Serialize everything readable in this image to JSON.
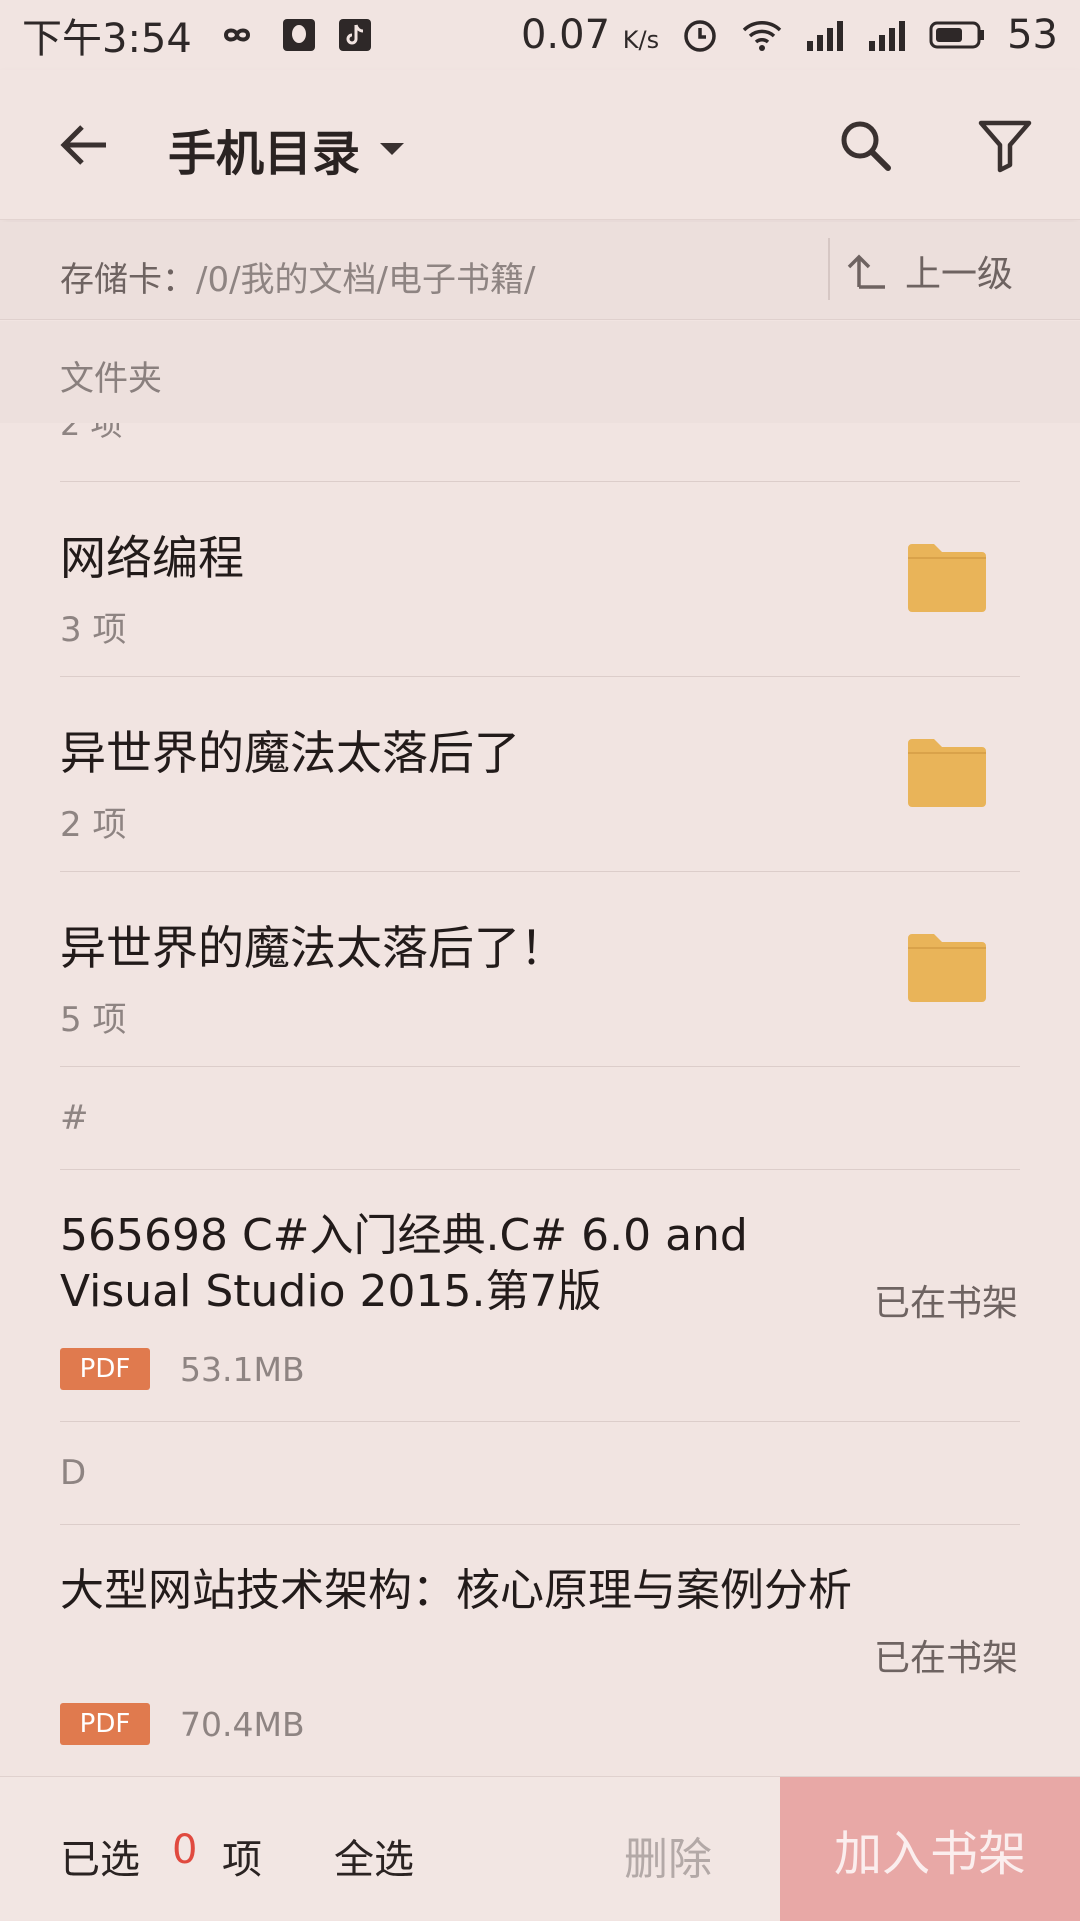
{
  "status_bar": {
    "time": "下午3:54",
    "net_speed": "0.07",
    "net_unit": "K/s",
    "battery": "53"
  },
  "app_bar": {
    "title": "手机目录"
  },
  "path_bar": {
    "label": "存储卡：",
    "path": "/0/我的文档/电子书籍/",
    "up_label": "上一级"
  },
  "folders_section": {
    "header": "文件夹",
    "partial_count": "2 项",
    "items": [
      {
        "name": "网络编程",
        "count": "3 项"
      },
      {
        "name": "异世界的魔法太落后了",
        "count": "2 项"
      },
      {
        "name": "异世界的魔法太落后了！",
        "count": "5 项"
      }
    ]
  },
  "files_sections": [
    {
      "letter": "#",
      "file": {
        "title": "565698 C#入门经典.C# 6.0 and Visual Studio 2015.第7版",
        "type": "PDF",
        "size": "53.1MB",
        "status": "已在书架"
      }
    },
    {
      "letter": "D",
      "file": {
        "title": "大型网站技术架构：核心原理与案例分析",
        "type": "PDF",
        "size": "70.4MB",
        "status": "已在书架"
      }
    }
  ],
  "bottom_bar": {
    "selected_label": "已选",
    "selected_count": "0",
    "selected_unit": "项",
    "select_all": "全选",
    "delete": "删除",
    "add_to_shelf": "加入书架"
  },
  "colors": {
    "background": "#f1e4e1",
    "folder": "#e9b459",
    "pdf_badge": "#e07a4e",
    "add_button": "#e8a8a6",
    "selected_count": "#e04a3f"
  }
}
